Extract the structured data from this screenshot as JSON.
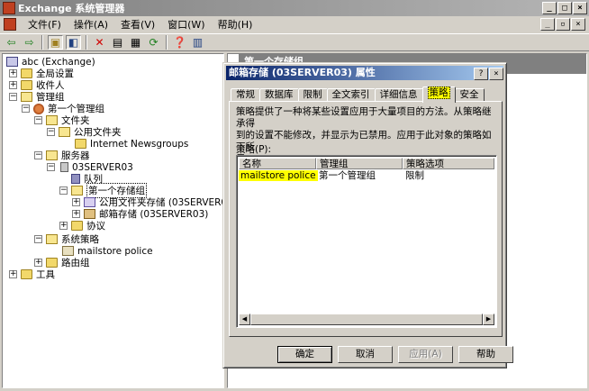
{
  "window": {
    "title": "Exchange 系统管理器",
    "minimize": "_",
    "maximize": "□",
    "close": "×"
  },
  "menu": {
    "items": [
      "文件(F)",
      "操作(A)",
      "查看(V)",
      "窗口(W)",
      "帮助(H)"
    ]
  },
  "toolbar": {
    "icons": [
      "back-arrow-icon",
      "forward-arrow-icon",
      "up-folder-icon",
      "show-tree-icon",
      "delete-icon",
      "properties-icon",
      "export-icon",
      "refresh-icon",
      "help-icon",
      "console-icon"
    ]
  },
  "tree": {
    "root": "abc (Exchange)",
    "global": "全局设置",
    "recipients": "收件人",
    "admin_groups": "管理组",
    "first_admin_group": "第一个管理组",
    "folders": "文件夹",
    "public_folders": "公用文件夹",
    "internet_newsgroups": "Internet Newsgroups",
    "servers": "服务器",
    "server": "03SERVER03",
    "queues": "队列",
    "first_storage_group": "第一个存储组",
    "public_store": "公用文件夹存储 (03SERVER03)",
    "mailbox_store": "邮箱存储 (03SERVER03)",
    "protocols": "协议",
    "system_policies": "系统策略",
    "mailstore_policy": "mailstore police",
    "routing_groups": "路由组",
    "tools": "工具"
  },
  "right_header": "第一个存储组",
  "dialog": {
    "title": "邮箱存储 (03SERVER03) 属性",
    "help_btn": "?",
    "close_btn": "×",
    "tabs": [
      "常规",
      "数据库",
      "限制",
      "全文索引",
      "详细信息",
      "策略",
      "安全"
    ],
    "active_tab": "策略",
    "description_line1": "策略提供了一种将某些设置应用于大量项目的方法。从策略继承得",
    "description_line2": "到的设置不能修改，并显示为已禁用。应用于此对象的策略如下所",
    "description_line3": "示。",
    "policy_label": "策略(P):",
    "columns": [
      "名称",
      "管理组",
      "策略选项"
    ],
    "rows": [
      {
        "name": "mailstore police",
        "group": "第一个管理组",
        "option": "限制"
      }
    ],
    "ok": "确定",
    "cancel": "取消",
    "apply": "应用(A)",
    "help": "帮助"
  }
}
